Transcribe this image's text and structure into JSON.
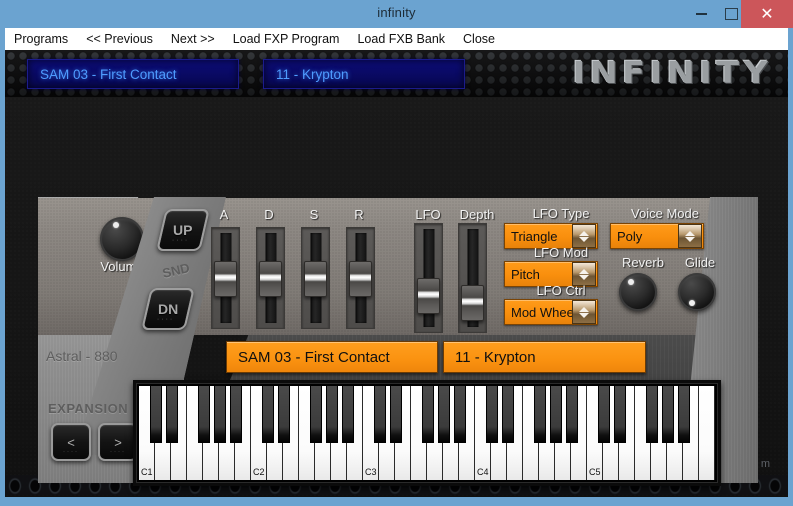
{
  "window": {
    "title": "infinity",
    "minimize_label": "–",
    "maximize_label": "□",
    "close_label": "✕"
  },
  "menu": {
    "items": [
      {
        "label": "Programs"
      },
      {
        "label": "<< Previous"
      },
      {
        "label": "Next >>"
      },
      {
        "label": "Load FXP Program"
      },
      {
        "label": "Load FXB Bank"
      },
      {
        "label": "Close"
      }
    ]
  },
  "header": {
    "lcd_patch": "SAM 03 - First Contact",
    "lcd_bank": "11 - Krypton",
    "brand": "INFINITY"
  },
  "panel": {
    "model_name": "Astral - 880",
    "snd_label": "SND",
    "snd_up": "UP",
    "snd_down": "DN",
    "btn_dots": "····",
    "volume_label": "Volume",
    "expansion_label": "EXPANSION",
    "expansion_prev": "<",
    "expansion_next": ">",
    "display_patch": "SAM 03 - First Contact",
    "display_bank": "11 - Krypton"
  },
  "sliders": [
    {
      "label": "A",
      "value_pct": 50
    },
    {
      "label": "D",
      "value_pct": 50
    },
    {
      "label": "S",
      "value_pct": 50
    },
    {
      "label": "R",
      "value_pct": 50
    },
    {
      "label": "LFO",
      "value_pct": 27
    },
    {
      "label": "Depth",
      "value_pct": 18
    }
  ],
  "combos": [
    {
      "label": "LFO Type",
      "value": "Triangle"
    },
    {
      "label": "LFO Mod",
      "value": "Pitch"
    },
    {
      "label": "LFO Ctrl",
      "value": "Mod Wheel"
    },
    {
      "label": "Voice Mode",
      "value": "Poly"
    }
  ],
  "knobs": [
    {
      "name": "volume",
      "label": "Volume",
      "angle_deg": -25
    },
    {
      "name": "reverb",
      "label": "Reverb",
      "angle_deg": -35
    },
    {
      "name": "glide",
      "label": "Glide",
      "angle_deg": 205
    }
  ],
  "keyboard": {
    "octave_labels": [
      "C1",
      "C2",
      "C3",
      "C4",
      "C5"
    ],
    "white_key_count": 36,
    "start_note": "C1"
  },
  "footer": {
    "watermark": "w w w . i r i s h a c t s . c o m"
  },
  "colors": {
    "accent_orange": "#fa9210",
    "lcd_blue": "#4f9cff",
    "lcd_bg": "#0a0a66",
    "titlebar": "#6ba3d0",
    "close_red": "#cc565a"
  }
}
